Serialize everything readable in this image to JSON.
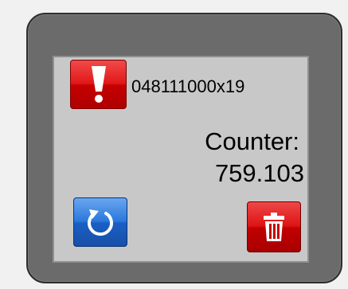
{
  "panel": {
    "device_id": "048111000x19",
    "counter_label": "Counter:",
    "counter_value": "759.103"
  },
  "buttons": {
    "alert_icon": "exclamation-icon",
    "reset_icon": "refresh-icon",
    "delete_icon": "trash-icon"
  },
  "colors": {
    "frame": "#6b6b6b",
    "screen": "#c8c8c8",
    "alert_red": "#e11818",
    "reset_blue": "#2a78dc"
  }
}
